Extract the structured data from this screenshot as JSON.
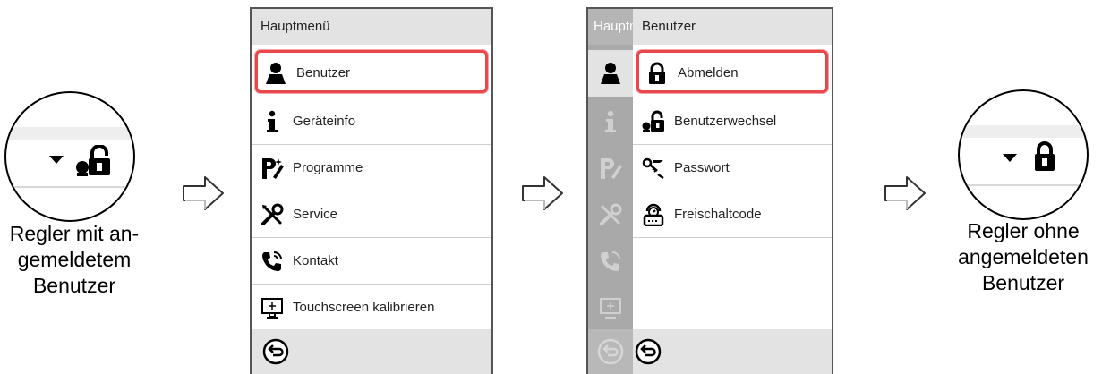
{
  "left_panel": {
    "caption_lines": [
      "Regler mit an-",
      "gemeldetem",
      "Benutzer"
    ],
    "status_icon": "unlocked-user-icon"
  },
  "right_panel": {
    "caption_lines": [
      "Regler ohne",
      "angemeldeten",
      "Benutzer"
    ],
    "status_icon": "lock-icon"
  },
  "main_menu": {
    "title": "Hauptmenü",
    "items": [
      {
        "label": "Benutzer",
        "icon": "user-icon",
        "selected": true
      },
      {
        "label": "Geräteinfo",
        "icon": "info-icon"
      },
      {
        "label": "Programme",
        "icon": "programs-icon"
      },
      {
        "label": "Service",
        "icon": "service-tools-icon"
      },
      {
        "label": "Kontakt",
        "icon": "phone-icon"
      },
      {
        "label": "Touchscreen kalibrieren",
        "icon": "touchscreen-icon"
      }
    ]
  },
  "user_menu": {
    "rail_title": "Hauptmenü",
    "title": "Benutzer",
    "items": [
      {
        "label": "Abmelden",
        "icon": "lock-icon",
        "selected": true
      },
      {
        "label": "Benutzerwechsel",
        "icon": "user-switch-icon"
      },
      {
        "label": "Passwort",
        "icon": "password-key-icon"
      },
      {
        "label": "Freischaltcode",
        "icon": "unlock-code-icon"
      }
    ]
  },
  "colors": {
    "selection_border": "#e8474b",
    "title_bar": "#e3e3e3",
    "rail": "#a9a9a9"
  }
}
